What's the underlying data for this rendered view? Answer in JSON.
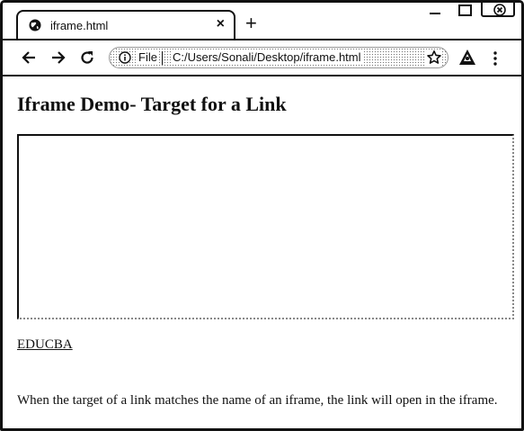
{
  "tab": {
    "title": "iframe.html",
    "close_glyph": "×",
    "favicon": "globe-icon"
  },
  "newtab_glyph": "+",
  "toolbar": {
    "back": "arrow-left-icon",
    "forward": "arrow-right-icon",
    "reload": "reload-icon"
  },
  "omnibox": {
    "scheme_label": "File",
    "url": "C:/Users/Sonali/Desktop/iframe.html"
  },
  "page": {
    "title": "Iframe Demo- Target for a Link",
    "link_text": "EDUCBA",
    "description": "When the target of a link matches the name of an iframe, the link will open in the iframe."
  }
}
